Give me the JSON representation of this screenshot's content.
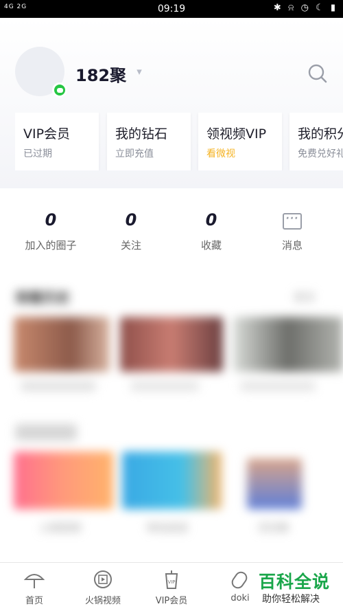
{
  "status_bar": {
    "signal": "4G 2G",
    "time": "09:19"
  },
  "profile": {
    "username": "182聚",
    "cards": [
      {
        "title": "VIP会员",
        "subtitle": "已过期"
      },
      {
        "title": "我的钻石",
        "subtitle": "立即充值"
      },
      {
        "title": "领视频VIP",
        "subtitle": "看微视",
        "subtitle_color": "#f5b323"
      },
      {
        "title": "我的积分",
        "subtitle": "免费兑好礼"
      }
    ]
  },
  "stats": [
    {
      "value": "0",
      "label": "加入的圈子"
    },
    {
      "value": "0",
      "label": "关注"
    },
    {
      "value": "0",
      "label": "收藏"
    },
    {
      "label": "消息"
    }
  ],
  "history": {
    "title": "观看历史",
    "more": "更多"
  },
  "apps": {
    "items": [
      "火锅视频",
      "咪咕阅读",
      "灵剑尊"
    ]
  },
  "bottom_nav": [
    {
      "label": "首页",
      "icon": "umbrella-icon"
    },
    {
      "label": "火锅视频",
      "icon": "play-circle-icon"
    },
    {
      "label": "VIP会员",
      "icon": "vip-cup-icon"
    },
    {
      "label": "doki",
      "icon": "doki-icon"
    }
  ],
  "watermark": {
    "title": "百科全说",
    "subtitle": "助你轻松解决"
  },
  "colors": {
    "accent_green": "#26c643",
    "gold": "#f5b323",
    "watermark_green": "#1aa64a"
  }
}
